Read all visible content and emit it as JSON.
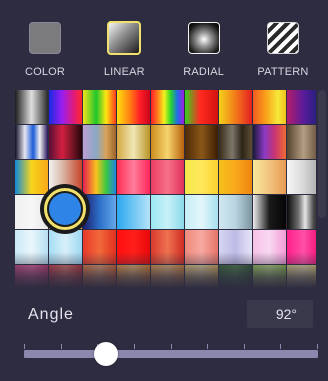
{
  "tabs": [
    {
      "key": "color",
      "label": "COLOR",
      "icon": "solid-color-icon"
    },
    {
      "key": "linear",
      "label": "LINEAR",
      "icon": "linear-gradient-icon",
      "active": true
    },
    {
      "key": "radial",
      "label": "RADIAL",
      "icon": "radial-gradient-icon"
    },
    {
      "key": "pattern",
      "label": "PATTERN",
      "icon": "pattern-icon"
    }
  ],
  "selected_color": "#2f84e8",
  "swatches": [
    [
      "linear-gradient(90deg,#1d1d1d,#e0e0e0 50%,#2a2a2a)",
      "linear-gradient(90deg,#1a2ae0,#9a1ef0 40%,#e01b7a 75%,#ff2a2a)",
      "linear-gradient(90deg,#f4e21a,#1ec62b 40%,#ffe610 70%,#ff3b1c)",
      "linear-gradient(90deg,#ffe00f,#ff7d12 40%,#ff1d26 70%,#c9051b)",
      "linear-gradient(90deg,#ff1e27,#ff7a1d 20%,#f3f11c 40%,#2bd62a 60%,#1f6de8 80%,#a21de3)",
      "linear-gradient(90deg,#32d11e,#ff2b21 45%,#d3130f)",
      "linear-gradient(90deg,#f5d31b,#f27a1a 50%,#e41e22)",
      "linear-gradient(90deg,#f25a21,#f9a31a 40%,#f6e73a 75%,#f0c31c)",
      "linear-gradient(90deg,#b31d6b,#5a1b9a 50%,#1a2178)",
      "linear-gradient(90deg,#c7dd4a,#8fc93a 50%,#e7f03c)"
    ],
    [
      "linear-gradient(90deg,#0e0e25,#e7e7f3 30%,#1c5cd9 55%,#f0f0f0 75%,#25135a)",
      "linear-gradient(90deg,#571036,#d31f40 40%,#7a1526 70%,#230509)",
      "linear-gradient(90deg,#bd9fd0,#8aa8c5 40%,#d9a35a 70%,#9d6429)",
      "linear-gradient(90deg,#d6a843,#f0e7b6 50%,#b99325)",
      "linear-gradient(90deg,#cb8d1d,#f6d46e 50%,#b8620c)",
      "linear-gradient(90deg,#4d2a08,#8a5717 50%,#3d1e03)",
      "linear-gradient(90deg,#382a17,#7d7769 40%,#2d2418 70%,#5f4f33)",
      "linear-gradient(90deg,#1a1a38,#8b3ac4 35%,#c73274 65%,#f06c31)",
      "linear-gradient(90deg,#54432e,#b49e83 50%,#5b4630)",
      "linear-gradient(90deg,#1c1c1c,#8a8a8a 50%,#e4e4e4)"
    ],
    [
      "linear-gradient(90deg,#0f8bd9,#f7d51c 50%,#f9a81a)",
      "linear-gradient(90deg,#f2f2f2,#d9b9a9 40%,#c6442a)",
      "linear-gradient(90deg,#e31e4f,#f9c31e 40%,#3cc741 70%,#1e85e0)",
      "linear-gradient(90deg,#ff2d52,#ff7d9b 50%,#ff245a)",
      "linear-gradient(90deg,#ed3c60,#f7718a 50%,#e0315a)",
      "linear-gradient(90deg,#f4e84d,#ffe85c 50%,#f9d12e)",
      "linear-gradient(90deg,#f4c11a,#f9a81b 50%,#f0840f)",
      "linear-gradient(90deg,#f7e89a,#f2c37d 50%,#e89b53)",
      "linear-gradient(90deg,#f7f7f7,#d8d8d8 50%,#a7a7a7)",
      "linear-gradient(90deg,#f4f4f4,#dadada 50%,#bfbfbf)"
    ],
    [
      "linear-gradient(90deg,#efefef,#f7f7f7 50%,#e6e6e6)",
      "linear-gradient(90deg,#ffe4b8,#f8c888 50%,#f3ae57)",
      "linear-gradient(90deg,#1c1c6d,#2d70c8 50%,#65a7e8)",
      "linear-gradient(90deg,#2aa8f0,#71c6f4 50%,#b4e3f8)",
      "linear-gradient(90deg,#9ae7f2,#c7f1f8 50%,#8bd9ea)",
      "linear-gradient(90deg,#c5eef5,#e3f6fa 50%,#a7e1ee)",
      "linear-gradient(90deg,#d1e7f2,#b8d4e0 50%,#7c94a0)",
      "linear-gradient(90deg,#ececec,#1a1a1a 50%,#050505)",
      "linear-gradient(90deg,#0a0a0a,#707070 35%,#e6e6e6 55%,#4d4d4d 80%,#111111)",
      "linear-gradient(90deg,#f2f2f2,#3a3a3a 40%,#0d0d0d)"
    ],
    [
      "linear-gradient(90deg,#c9e9f6,#eaf7fc 50%,#b7dff2)",
      "linear-gradient(90deg,#a6def5,#d8f0fa 50%,#9ed8f2)",
      "linear-gradient(90deg,#e83a2a,#f26a3b 50%,#e2301f)",
      "linear-gradient(90deg,#ff0f0f,#ff1f1a 50%,#e80808)",
      "linear-gradient(90deg,#d83a2c,#ef7150 50%,#cf2c22)",
      "linear-gradient(90deg,#ef8a7d,#f7a9a0 50%,#e67469)",
      "linear-gradient(90deg,#d7d6f2,#bdbbe6 50%,#e7e6f9)",
      "linear-gradient(90deg,#f8c2e7,#f9d8f0 50%,#f29bd5)",
      "linear-gradient(90deg,#ff1f8a,#ff4fa6 50%,#f00c73)",
      "linear-gradient(90deg,#ffffff,#ffffff)"
    ],
    [
      "linear-gradient(90deg,#d34a86,#ed6aa5 50%,#c7386f)",
      "linear-gradient(90deg,#d53c4a,#ef7b6a 50%,#c42e38)",
      "linear-gradient(90deg,#f4813f,#f9b07a 50%,#e86a2b)",
      "linear-gradient(90deg,#f9a03d,#fcc47a 50%,#f08b24)",
      "linear-gradient(90deg,#f0a24d,#f8c581 50%,#e58f34)",
      "linear-gradient(90deg,#f2d17a,#f9e5a6 50%,#e6bd58)",
      "linear-gradient(90deg,#3a6d3a,#4e8a4a 50%,#2f5a2f)",
      "linear-gradient(90deg,#a3d85c,#c5ea8b 50%,#8fc843)",
      "linear-gradient(90deg,#f0df89,#f8ecb2 50%,#e6cd63)",
      "linear-gradient(90deg,#f6e9bd,#faf2d6 50%,#eedc9f)"
    ]
  ],
  "angle": {
    "label": "Angle",
    "value": "92°",
    "fraction": 0.28
  },
  "slider": {
    "ticks": 9
  }
}
